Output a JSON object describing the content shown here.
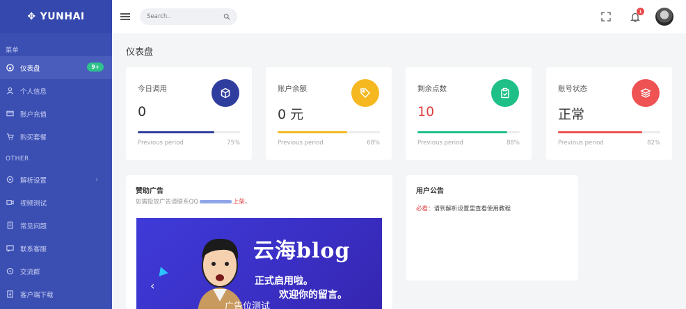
{
  "brand": {
    "name": "YUNHAI"
  },
  "sidebar": {
    "section_menu": "菜单",
    "section_other": "OTHER",
    "items": [
      {
        "label": "仪表盘",
        "icon": "dashboard-icon",
        "active": true,
        "badge": "9+"
      },
      {
        "label": "个人信息",
        "icon": "user-icon"
      },
      {
        "label": "账户充值",
        "icon": "wallet-icon"
      },
      {
        "label": "购买套餐",
        "icon": "cart-icon"
      }
    ],
    "other_items": [
      {
        "label": "解析设置",
        "icon": "settings-icon",
        "chevron": "›"
      },
      {
        "label": "视频测试",
        "icon": "video-icon"
      },
      {
        "label": "常见问题",
        "icon": "document-icon"
      },
      {
        "label": "联系客服",
        "icon": "chat-icon"
      },
      {
        "label": "交流群",
        "icon": "group-icon"
      },
      {
        "label": "客户端下载",
        "icon": "download-icon"
      }
    ]
  },
  "header": {
    "search_placeholder": "Search..",
    "notification_count": "1"
  },
  "page": {
    "title": "仪表盘"
  },
  "stats": [
    {
      "label": "今日调用",
      "value": "0",
      "icon": "cube-icon",
      "color": "#2f3e9e",
      "progress": 75,
      "foot_label": "Previous period",
      "foot_value": "75%"
    },
    {
      "label": "账户余额",
      "value": "0 元",
      "icon": "tag-icon",
      "color": "#f5b820",
      "progress": 68,
      "foot_label": "Previous period",
      "foot_value": "68%"
    },
    {
      "label": "剩余点数",
      "value": "10",
      "icon": "clipboard-icon",
      "color": "#1fc087",
      "progress": 88,
      "foot_label": "Previous period",
      "foot_value": "88%"
    },
    {
      "label": "账号状态",
      "value": "正常",
      "icon": "layers-icon",
      "color": "#ee5252",
      "progress": 82,
      "foot_label": "Previous period",
      "foot_value": "82%"
    }
  ],
  "ad_panel": {
    "title": "赞助广告",
    "sub_prefix": "如需投放广告请联系QQ",
    "sub_link": "上架",
    "sub_suffix": "。",
    "banner_title": "云海blog",
    "banner_line1": "正式启用啦。",
    "banner_line2": "欢迎你的留言。",
    "banner_overlay": "广告位测试"
  },
  "notice_panel": {
    "title": "用户公告",
    "must": "必看：",
    "text": "请到解析设置里查看使用教程"
  }
}
